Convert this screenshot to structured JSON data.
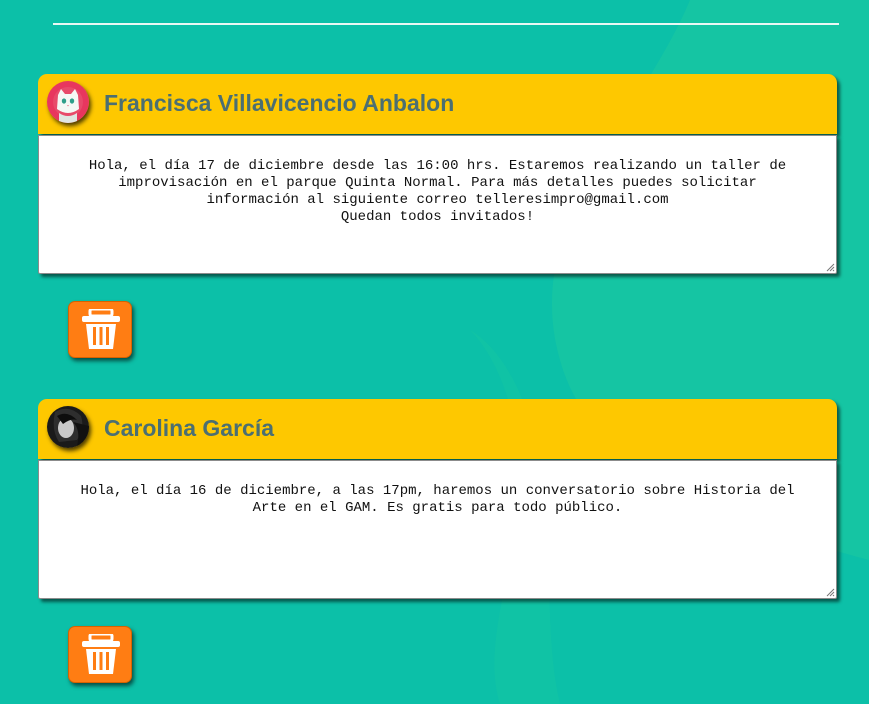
{
  "posts": [
    {
      "author": "Francisca Villavicencio Anbalon",
      "avatar_icon": "cat-avatar-icon",
      "message": "Hola, el día 17 de diciembre desde las 16:00 hrs. Estaremos realizando un taller de improvisación en el parque Quinta Normal. Para más detalles puedes solicitar información al siguiente correo telleresimpro@gmail.com\nQuedan todos invitados!",
      "delete_icon": "trash-icon"
    },
    {
      "author": "Carolina García",
      "avatar_icon": "person-avatar-icon",
      "message": "Hola, el día 16 de diciembre, a las 17pm, haremos un conversatorio sobre Historia del Arte en el GAM. Es gratis para todo público.",
      "delete_icon": "trash-icon"
    }
  ],
  "colors": {
    "background": "#0cc0a8",
    "header": "#fec800",
    "author_text": "#4b6f72",
    "delete_button": "#ff7d13"
  }
}
